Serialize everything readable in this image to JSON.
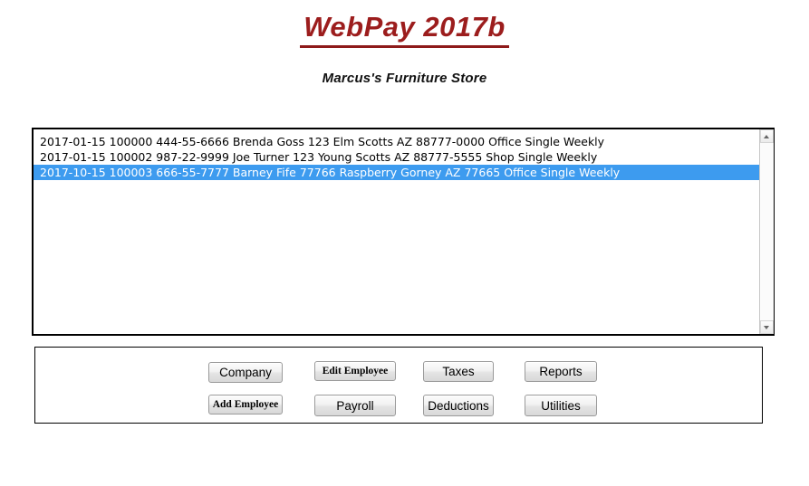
{
  "header": {
    "app_title": "WebPay 2017b",
    "company_subtitle": "Marcus's Furniture Store",
    "title_color": "#9c1d1d",
    "underline_color": "#8e1a1a"
  },
  "employee_list": {
    "selection_color": "#3d9bef",
    "rows": [
      {
        "text": "2017-01-15 100000 444-55-6666 Brenda Goss 123 Elm Scotts AZ 88777-0000 Office Single Weekly",
        "selected": false
      },
      {
        "text": "2017-01-15 100002 987-22-9999 Joe Turner 123 Young Scotts AZ 88777-5555 Shop Single Weekly",
        "selected": false
      },
      {
        "text": "2017-10-15 100003 666-55-7777 Barney Fife 77766 Raspberry Gorney AZ 77665 Office Single Weekly",
        "selected": true
      }
    ],
    "scrollbar": {
      "up_icon": "scroll-up-arrow-icon",
      "down_icon": "scroll-down-arrow-icon"
    }
  },
  "buttons": {
    "company": "Company",
    "edit_employee": "Edit Employee",
    "taxes": "Taxes",
    "reports": "Reports",
    "add_employee": "Add Employee",
    "payroll": "Payroll",
    "deductions": "Deductions",
    "utilities": "Utilities"
  }
}
